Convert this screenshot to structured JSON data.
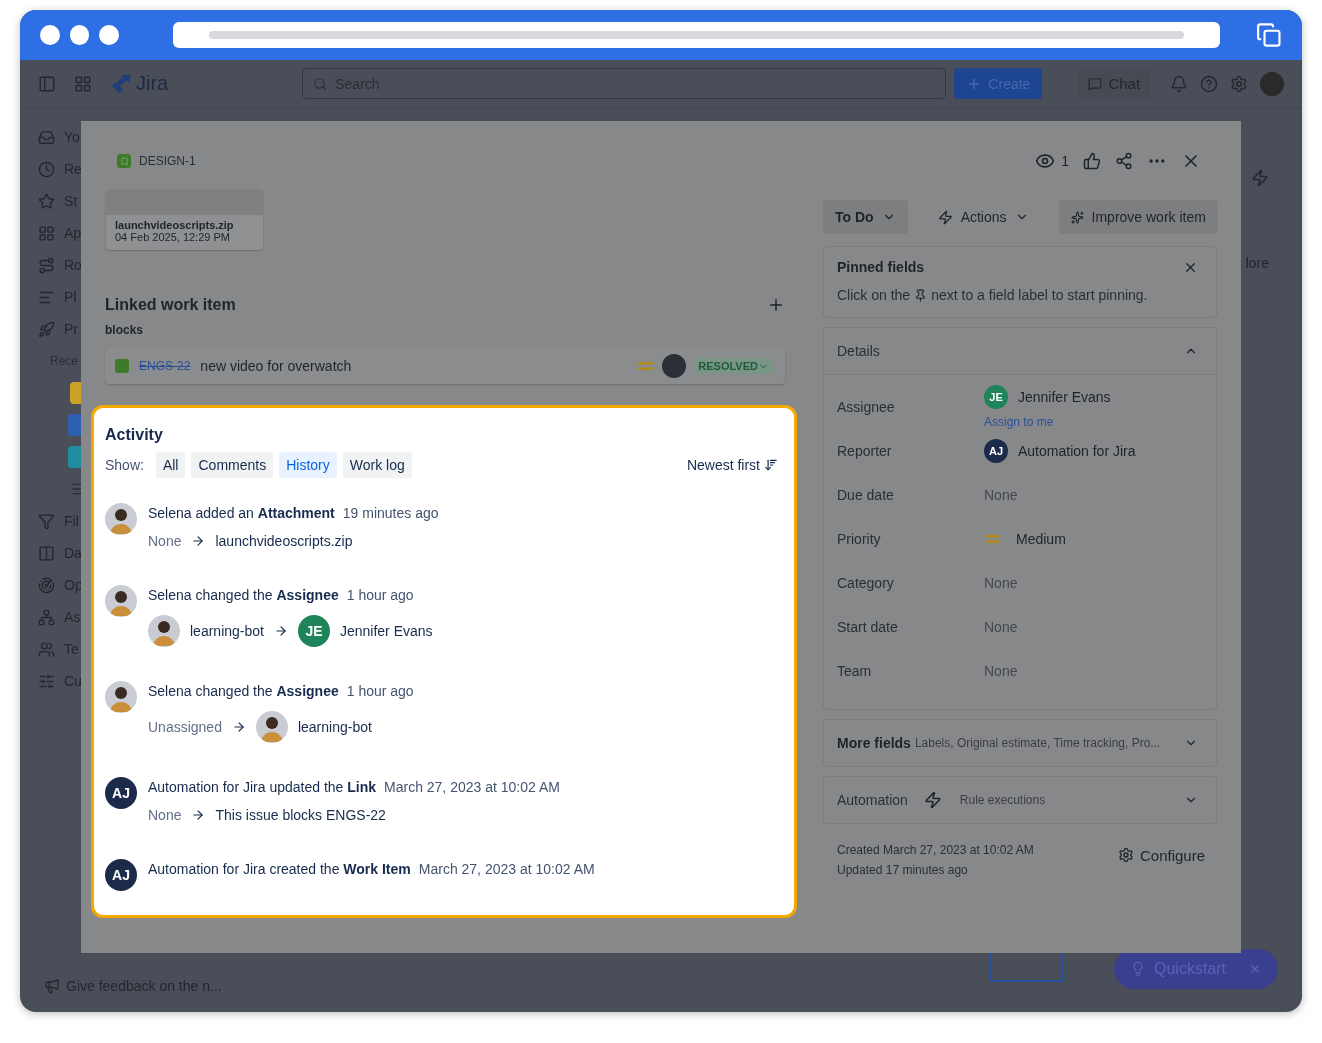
{
  "nav": {
    "product": "Jira",
    "search": {
      "placeholder": "Search"
    },
    "create": "Create",
    "chat": "Chat"
  },
  "sidebar": {
    "items": [
      {
        "label": "Yo"
      },
      {
        "label": "Re"
      },
      {
        "label": "St"
      },
      {
        "label": "Ap"
      },
      {
        "label": "Ro"
      },
      {
        "label": "Pl"
      },
      {
        "label": "Pr"
      }
    ],
    "recent_heading": "Rece",
    "recent": [
      {
        "kind": "project",
        "color": "#c9a227"
      },
      {
        "kind": "project",
        "color": "#2f5fb0"
      },
      {
        "kind": "project",
        "color": "#1f8ea0"
      },
      {
        "kind": "list",
        "color": "#2a2e36"
      }
    ],
    "more_items": [
      {
        "label": "Fil"
      },
      {
        "label": "Da"
      },
      {
        "label": "Op"
      },
      {
        "label": "As"
      },
      {
        "label": "Te"
      },
      {
        "label": "Cu"
      }
    ],
    "feedback": "Give feedback on the n..."
  },
  "background": {
    "text": "lore"
  },
  "quickstart": "Quickstart",
  "work_item": {
    "key": "DESIGN-1",
    "attachment": {
      "name": "launchvideoscripts.zip",
      "date": "04 Feb 2025, 12:29 PM"
    },
    "linked": {
      "title": "Linked work item",
      "relation": "blocks",
      "items": [
        {
          "key": "ENGS-22",
          "summary": "new video for overwatch",
          "status": "RESOLVED",
          "done": true
        }
      ]
    },
    "watchers": "1",
    "status": "To Do",
    "actions": "Actions",
    "improve": "Improve work item",
    "pinned": {
      "title": "Pinned fields",
      "before": "Click on the",
      "after": "next to a field label to start pinning."
    },
    "details": {
      "title": "Details",
      "expanded": true,
      "fields": [
        {
          "label": "Assignee",
          "kind": "person",
          "value": "Jennifer Evans",
          "initials": "JE",
          "color": "#1f845a",
          "link": "Assign to me"
        },
        {
          "label": "Reporter",
          "kind": "person",
          "value": "Automation for Jira",
          "initials": "AJ",
          "color": "#1c2b4a"
        },
        {
          "label": "Due date",
          "kind": "empty",
          "value": "None"
        },
        {
          "label": "Priority",
          "kind": "priority",
          "value": "Medium"
        },
        {
          "label": "Category",
          "kind": "empty",
          "value": "None"
        },
        {
          "label": "Start date",
          "kind": "empty",
          "value": "None"
        },
        {
          "label": "Team",
          "kind": "empty",
          "value": "None"
        }
      ]
    },
    "more_fields": {
      "title": "More fields",
      "hint": "Labels, Original estimate, Time tracking, Pro..."
    },
    "automation": {
      "title": "Automation",
      "hint": "Rule executions"
    },
    "created": "Created March 27, 2023 at 10:02 AM",
    "updated": "Updated 17 minutes ago",
    "configure": "Configure"
  },
  "activity": {
    "title": "Activity",
    "show_label": "Show:",
    "sort": "Newest first",
    "tabs": [
      {
        "label": "All",
        "selected": false
      },
      {
        "label": "Comments",
        "selected": false
      },
      {
        "label": "History",
        "selected": true
      },
      {
        "label": "Work log",
        "selected": false
      }
    ],
    "items": [
      {
        "author": {
          "kind": "photo"
        },
        "summary": "Selena added an **Attachment**",
        "time": "19 minutes ago",
        "change": {
          "from": {
            "kind": "empty",
            "text": "None"
          },
          "to": {
            "kind": "text",
            "text": "launchvideoscripts.zip"
          }
        }
      },
      {
        "author": {
          "kind": "photo"
        },
        "summary": "Selena changed the **Assignee**",
        "time": "1 hour ago",
        "change": {
          "from": {
            "kind": "photo",
            "text": "learning-bot"
          },
          "to": {
            "kind": "initials",
            "initials": "JE",
            "color": "#1f845a",
            "text": "Jennifer Evans"
          }
        }
      },
      {
        "author": {
          "kind": "photo"
        },
        "summary": "Selena changed the **Assignee**",
        "time": "1 hour ago",
        "change": {
          "from": {
            "kind": "empty",
            "text": "Unassigned"
          },
          "to": {
            "kind": "photo",
            "text": "learning-bot"
          }
        }
      },
      {
        "author": {
          "kind": "initials",
          "initials": "AJ",
          "color": "#1c2b4a"
        },
        "summary": "Automation for Jira updated the **Link**",
        "time": "March 27, 2023 at 10:02 AM",
        "change": {
          "from": {
            "kind": "empty",
            "text": "None"
          },
          "to": {
            "kind": "text",
            "text": "This issue blocks ENGS-22"
          }
        }
      },
      {
        "author": {
          "kind": "initials",
          "initials": "AJ",
          "color": "#1c2b4a"
        },
        "summary": "Automation for Jira created the **Work Item**",
        "time": "March 27, 2023 at 10:02 AM"
      }
    ]
  }
}
